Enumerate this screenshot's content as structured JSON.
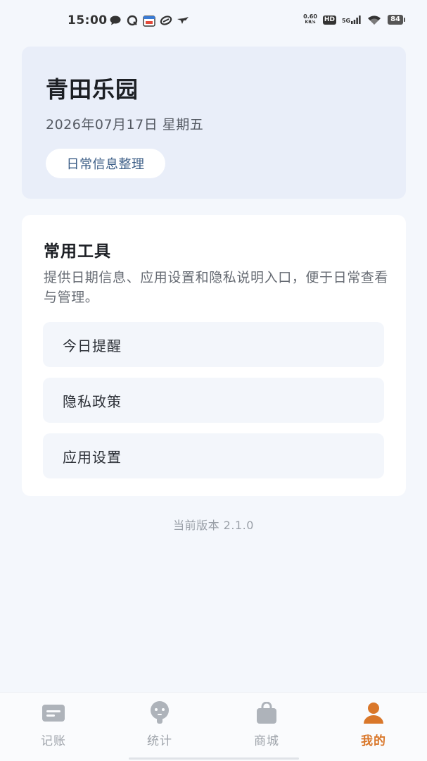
{
  "status_bar": {
    "time": "15:00",
    "net_speed_value": "0.60",
    "net_speed_unit": "KB/s",
    "hd_label": "HD",
    "network_label": "5G",
    "battery": "84",
    "left_icons": [
      "chat-bubble-icon",
      "qq-icon",
      "calendar-app-icon",
      "link-icon",
      "bird-icon"
    ],
    "right_icons": [
      "signal-icon",
      "wifi-icon",
      "battery-icon"
    ]
  },
  "header": {
    "title": "青田乐园",
    "date": "2026年07月17日 星期五",
    "tag": "日常信息整理"
  },
  "tools": {
    "title": "常用工具",
    "description": "提供日期信息、应用设置和隐私说明入口，便于日常查看与管理。",
    "items": [
      {
        "label": "今日提醒"
      },
      {
        "label": "隐私政策"
      },
      {
        "label": "应用设置"
      }
    ]
  },
  "version": "当前版本 2.1.0",
  "bottom_nav": {
    "items": [
      {
        "label": "记账",
        "icon": "ledger-icon"
      },
      {
        "label": "统计",
        "icon": "stats-icon"
      },
      {
        "label": "商城",
        "icon": "shopping-bag-icon"
      },
      {
        "label": "我的",
        "icon": "user-icon"
      }
    ],
    "active_index": 3
  },
  "colors": {
    "accent": "#d9772a",
    "inactive": "#9ea3aa",
    "header_bg": "#e9eef9",
    "pill_text": "#3b5d86"
  }
}
